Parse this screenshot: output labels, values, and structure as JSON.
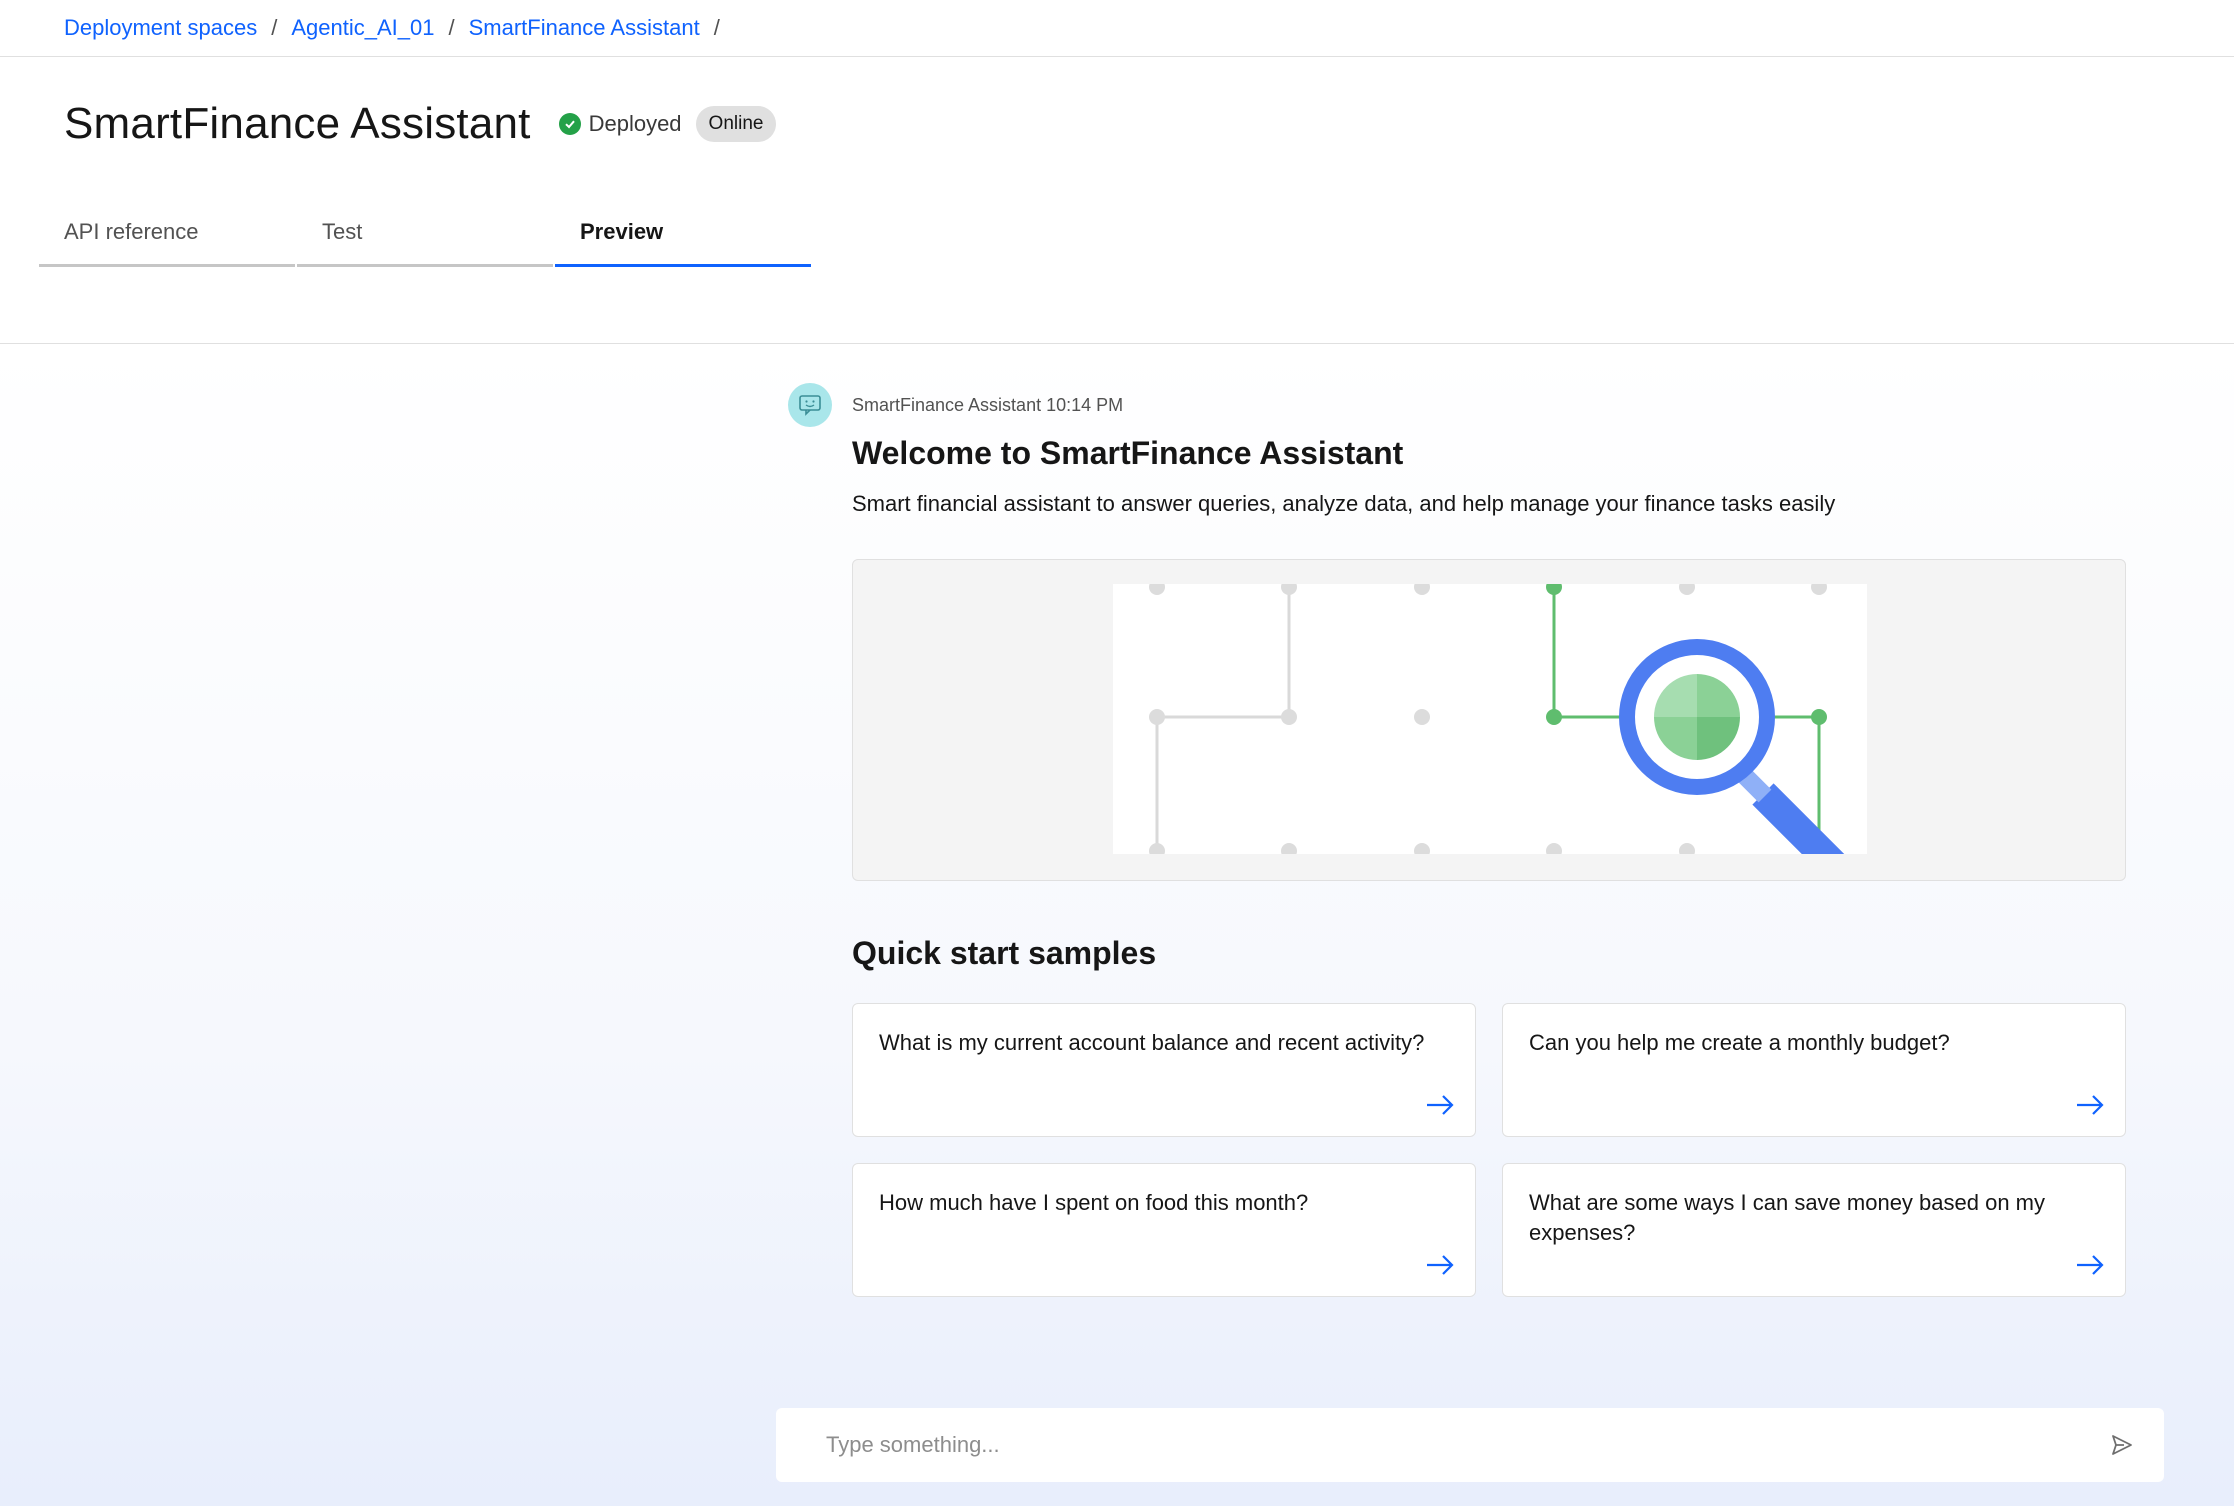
{
  "breadcrumb": {
    "items": [
      "Deployment spaces",
      "Agentic_AI_01",
      "SmartFinance Assistant"
    ],
    "separator": "/"
  },
  "header": {
    "title": "SmartFinance Assistant",
    "status": "Deployed",
    "badge": "Online",
    "status_color": "#24a148"
  },
  "tabs": [
    {
      "label": "API reference",
      "active": false
    },
    {
      "label": "Test",
      "active": false
    },
    {
      "label": "Preview",
      "active": true
    }
  ],
  "chat": {
    "sender": "SmartFinance Assistant",
    "time": "10:14 PM",
    "meta": "SmartFinance Assistant 10:14 PM",
    "welcome": "Welcome to SmartFinance Assistant",
    "description": "Smart financial assistant to answer queries, analyze data, and help manage your finance tasks easily",
    "samples_title": "Quick start samples",
    "samples": [
      "What is my current account balance and recent activity?",
      "Can you help me create a monthly budget?",
      "How much have I spent on food this month?",
      "What are some ways I can save money based on my expenses?"
    ]
  },
  "input": {
    "placeholder": "Type something..."
  },
  "colors": {
    "accent": "#0f62fe",
    "success": "#24a148",
    "avatar_bg": "#a9e6ea"
  }
}
